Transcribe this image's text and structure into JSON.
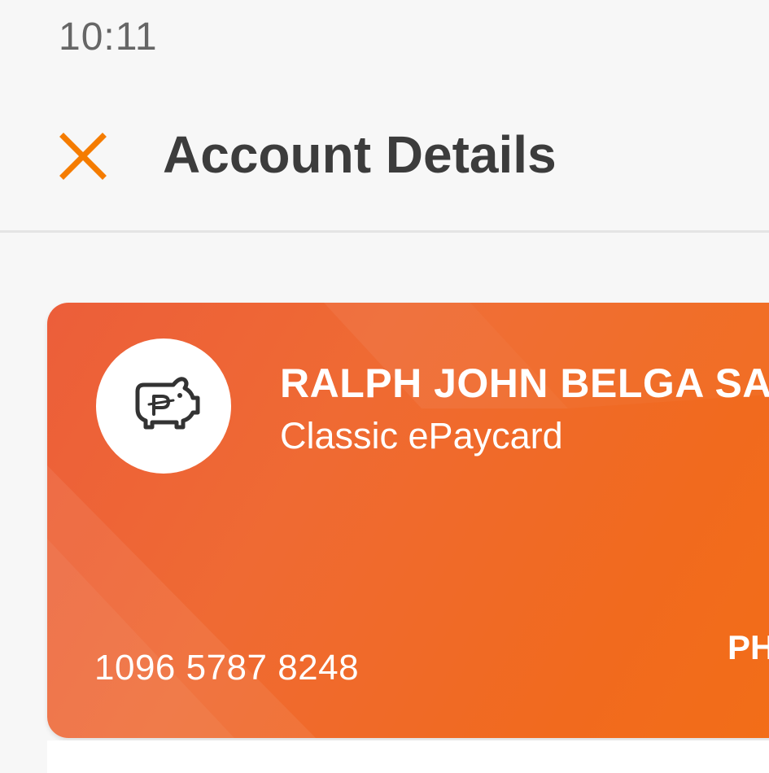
{
  "status_bar": {
    "time": "10:11"
  },
  "header": {
    "close_icon": "close-icon",
    "title": "Account Details"
  },
  "card": {
    "logo_icon": "piggy-bank-icon",
    "holder_name": "RALPH JOHN BELGA SA",
    "card_type": "Classic ePaycard",
    "account_number": "1096 5787 8248",
    "currency": "PH"
  },
  "colors": {
    "accent": "#f57c00",
    "card_start": "#ec5e3a",
    "card_end": "#f36e17",
    "title_text": "#3c3c3c"
  }
}
